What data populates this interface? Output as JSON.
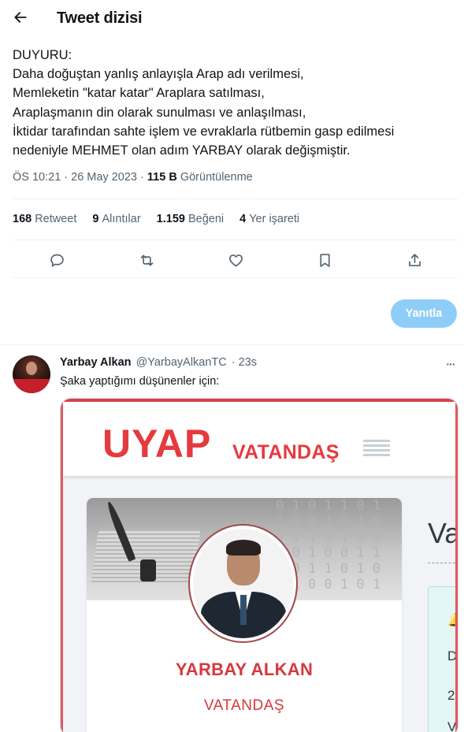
{
  "header": {
    "title": "Tweet dizisi"
  },
  "tweet": {
    "lines": [
      "DUYURU:",
      "Daha doğuştan yanlış anlayışla Arap adı verilmesi,",
      "Memleketin \"katar katar\" Araplara satılması,",
      "Araplaşmanın din olarak sunulması ve anlaşılması,",
      "İktidar tarafından sahte işlem ve evraklarla rütbemin gasp edilmesi",
      "nedeniyle MEHMET olan adım YARBAY olarak değişmiştir."
    ],
    "time": "ÖS 10:21 · 26 May 2023",
    "dot": "·",
    "views_value": "115 B",
    "views_label": "Görüntülenme"
  },
  "stats": {
    "retweets": {
      "num": "168",
      "label": "Retweet"
    },
    "quotes": {
      "num": "9",
      "label": "Alıntılar"
    },
    "likes": {
      "num": "1.159",
      "label": "Beğeni"
    },
    "bookmarks": {
      "num": "4",
      "label": "Yer işareti"
    }
  },
  "actions": [
    "reply-icon",
    "retweet-icon",
    "like-icon",
    "bookmark-icon",
    "share-icon"
  ],
  "reply_button": {
    "label": "Yanıtla",
    "color": "#8ecdf8"
  },
  "reply": {
    "name": "Yarbay Alkan",
    "handle": "@YarbayAlkanTC",
    "time": "· 23s",
    "text": "Şaka yaptığımı düşünenler için:",
    "more_label": "···"
  },
  "media": {
    "logo": "UYAP",
    "logo_sub": "VATANDAŞ",
    "card_name": "YARBAY ALKAN",
    "card_role": "VATANDAŞ",
    "side_peek": "Va",
    "side_letters": [
      "D",
      "2",
      "V"
    ],
    "binary_rows": [
      "0 1 0 1 1 0 1",
      "1 0 0 1 0 1 0",
      "0 1 1 0 1 0 0",
      "1 0 1 0 0 1 1",
      "0 0 1 1 0 1 0",
      "1 1 0 0 1 0 1"
    ],
    "brand_color": "#e53a3e"
  }
}
